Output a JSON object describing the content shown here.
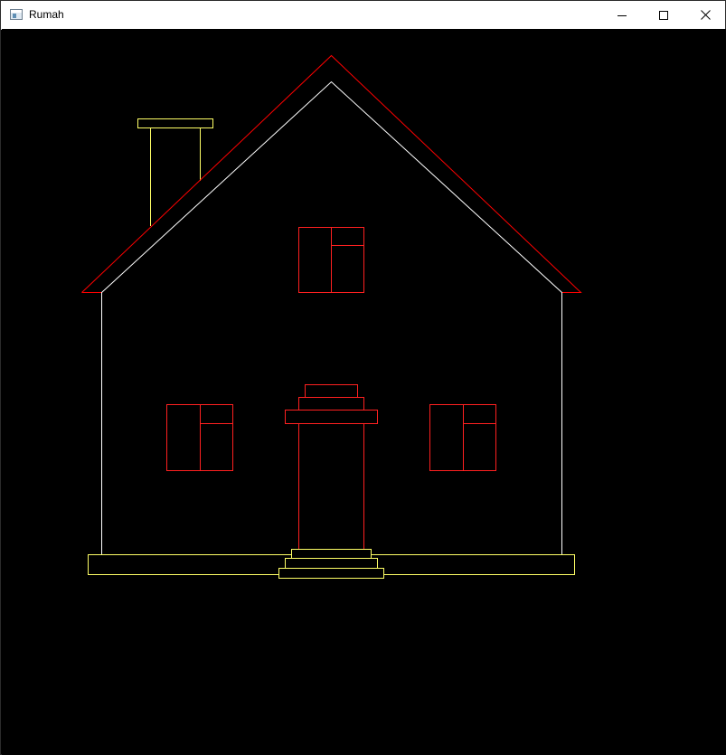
{
  "window": {
    "title": "Rumah",
    "icon": "app-window-icon",
    "controls": [
      {
        "name": "minimize-button",
        "icon": "minimize-icon"
      },
      {
        "name": "maximize-button",
        "icon": "maximize-icon"
      },
      {
        "name": "close-button",
        "icon": "close-icon"
      }
    ]
  },
  "canvas": {
    "background": "#000000",
    "colors": {
      "roof": "#ff0000",
      "walls": "#ffffff",
      "chimney": "#ffff66",
      "windows": "#ff2020",
      "door": "#ff2020",
      "foundation": "#ffff66",
      "steps": "#ffff66"
    }
  }
}
